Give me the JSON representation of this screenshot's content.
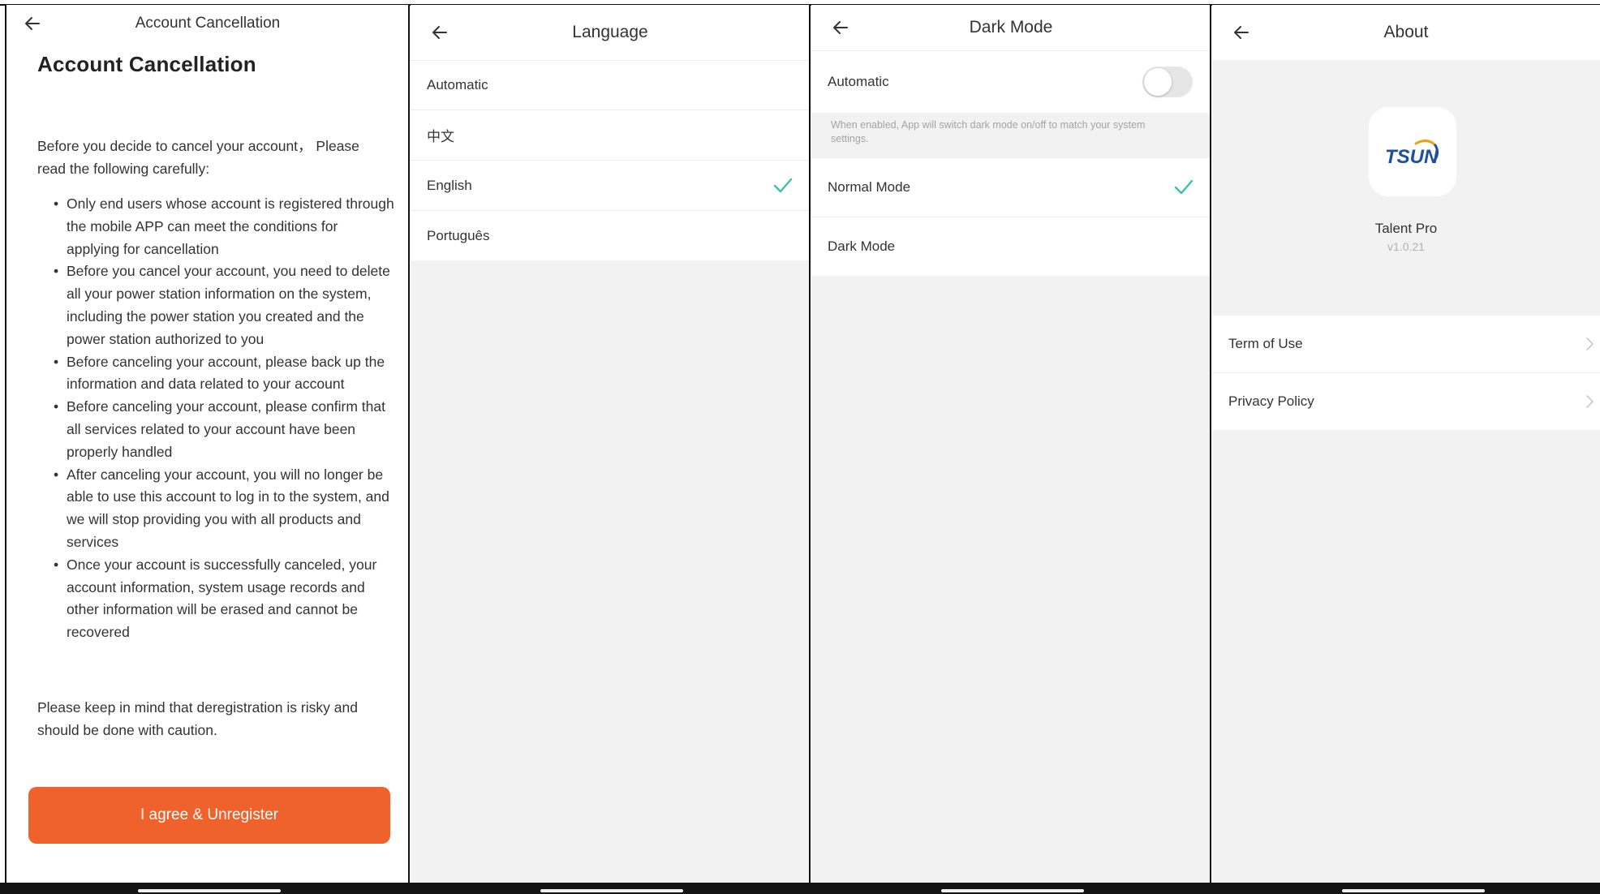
{
  "account_cancellation": {
    "header_title": "Account Cancellation",
    "heading": "Account Cancellation",
    "intro": "Before you decide to cancel your account， Please read the following carefully:",
    "bullets": [
      "Only end users whose account is registered through the mobile APP can meet the conditions for applying for cancellation",
      "Before you cancel your account, you need to delete all your power station information on the system, including the power station you created and the power station authorized to you",
      "Before canceling your account, please back up the information and data related to your account",
      "Before canceling your account, please confirm that all services related to your account have been properly handled",
      "After canceling your account, you will no longer be able to use this account to log in to the system, and we will stop providing you with all products and services",
      "Once your account is successfully canceled, your account information, system usage records and other information will be erased and cannot be recovered"
    ],
    "note": "Please keep in mind that deregistration is risky and should be done with caution.",
    "agree_button": "I agree & Unregister",
    "button_color": "#f0622b"
  },
  "language": {
    "header_title": "Language",
    "options": [
      "Automatic",
      "中文",
      "English",
      "Português"
    ],
    "selected": "English"
  },
  "dark_mode": {
    "header_title": "Dark Mode",
    "automatic_label": "Automatic",
    "automatic_enabled": false,
    "hint": "When enabled, App will switch dark mode on/off to match your system settings.",
    "options": [
      "Normal Mode",
      "Dark Mode"
    ],
    "selected": "Normal Mode"
  },
  "about": {
    "header_title": "About",
    "logo_text": "TSUN",
    "app_name": "Talent Pro",
    "version": "v1.0.21",
    "items": [
      "Term of Use",
      "Privacy Policy"
    ]
  },
  "colors": {
    "check": "#3bbfb0",
    "accent": "#f0622b",
    "logo_blue": "#1f4fa0",
    "logo_arc": "#e8a316"
  },
  "icons": {
    "back": "arrow-left-icon",
    "check": "check-icon",
    "chevron": "chevron-right-icon"
  }
}
